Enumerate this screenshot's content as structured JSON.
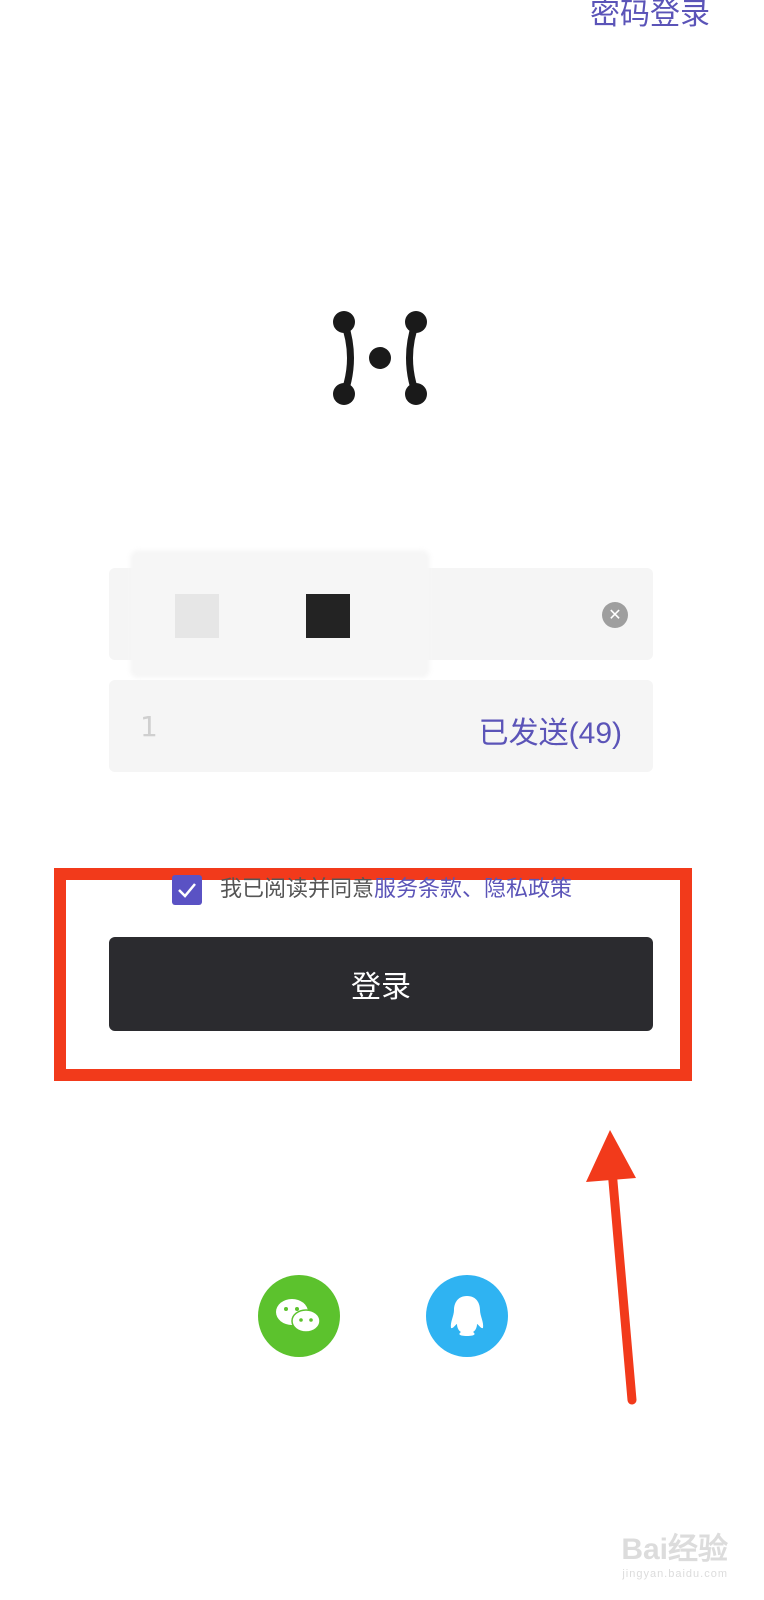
{
  "header": {
    "password_login_label": "密码登录"
  },
  "form": {
    "code_value": "1",
    "resend_label": "已发送(49)"
  },
  "agreement": {
    "prefix": "我已阅读并同意",
    "terms_label": "服务条款",
    "separator": "、",
    "privacy_label": "隐私政策",
    "checked": true
  },
  "login_button_label": "登录",
  "social": [
    {
      "icon": "wechat-icon"
    },
    {
      "icon": "qq-icon"
    }
  ],
  "colors": {
    "accent": "#5b54b8",
    "button": "#2b2b2f",
    "highlight": "#f23a1b",
    "wechat": "#5cc22d",
    "qq": "#2fb3f2"
  },
  "watermark": {
    "brand": "Bai经验",
    "url": "jingyan.baidu.com"
  }
}
